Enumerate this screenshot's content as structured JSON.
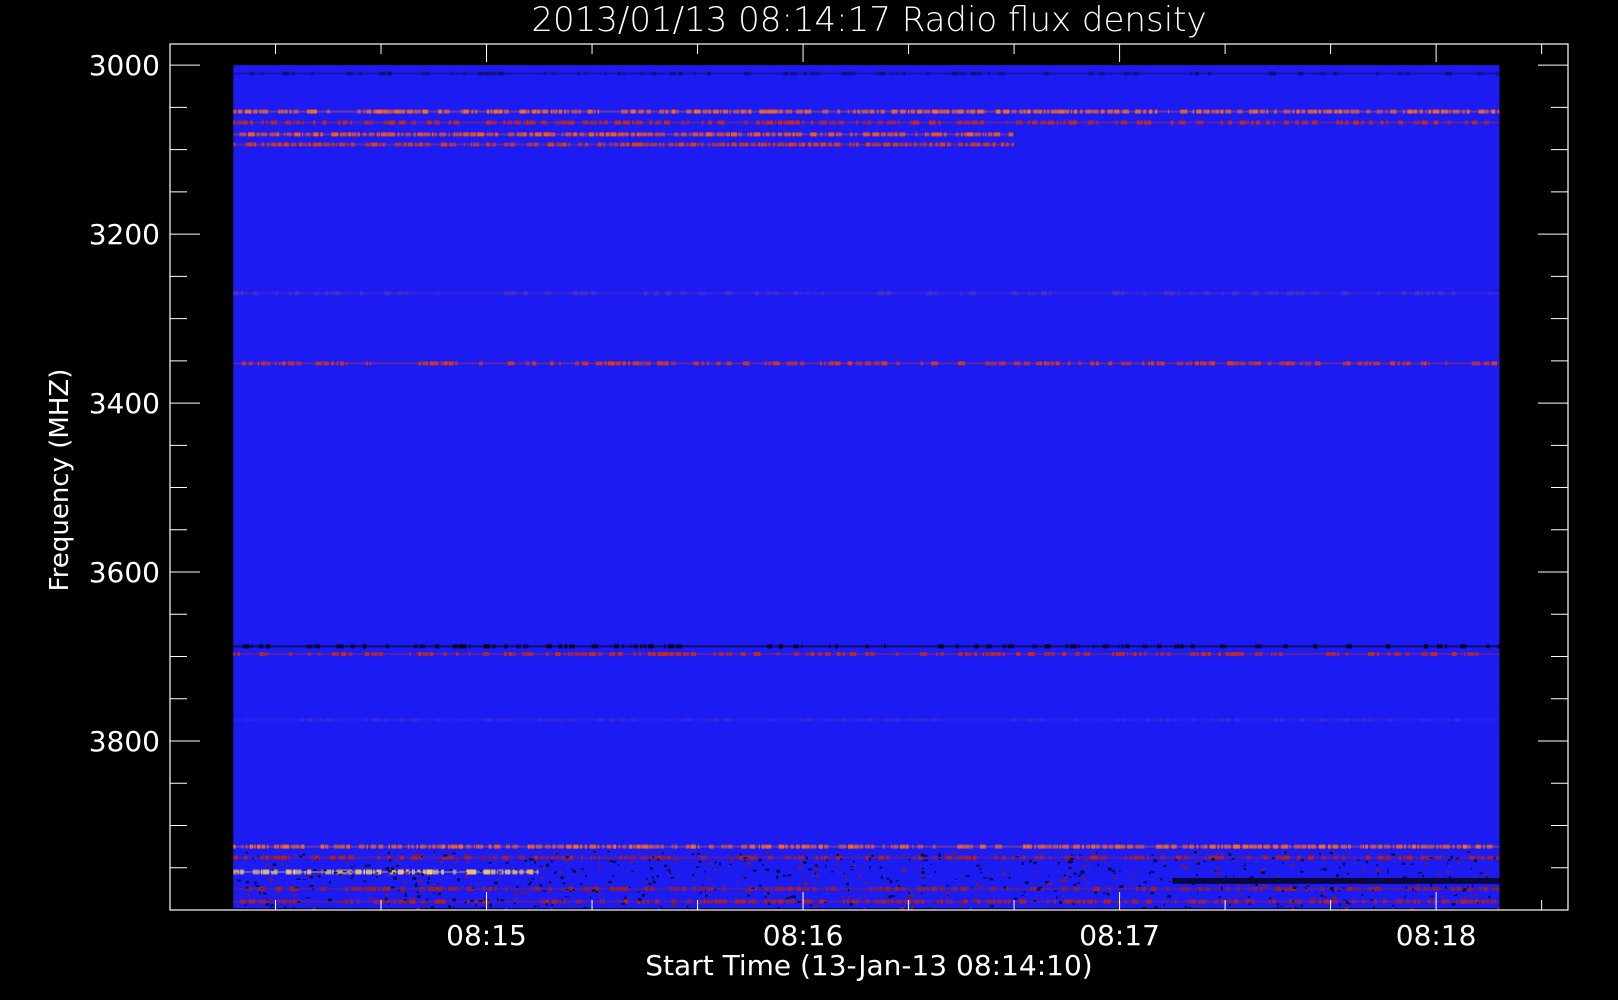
{
  "chart_data": {
    "type": "heatmap",
    "title": "2013/01/13 08:14:17 Radio flux density",
    "xlabel": "Start Time (13-Jan-13 08:14:10)",
    "ylabel": "Frequency (MHZ)",
    "x_ticks": [
      "08:15",
      "08:16",
      "08:17",
      "08:18"
    ],
    "y_ticks": [
      "3000",
      "3200",
      "3400",
      "3600",
      "3800"
    ],
    "y_tick_values": [
      3000,
      3200,
      3400,
      3600,
      3800
    ],
    "x_tick_seconds": [
      50,
      110,
      170,
      230
    ],
    "xlim_seconds": [
      -10,
      255
    ],
    "ylim": [
      2975,
      4000
    ],
    "data_extent": {
      "time_seconds": [
        2,
        242
      ],
      "frequency_mhz": [
        3000,
        3998
      ]
    },
    "orientation": "frequency increases downward",
    "background_color": "#1c1cf2",
    "colormap": [
      "#000000",
      "#1c1cf2",
      "#cc1a00",
      "#ff6a00",
      "#ffd060",
      "#ffffff"
    ],
    "grid": false,
    "bands": [
      {
        "freq": 3010,
        "intensity": "low",
        "color": "#101070",
        "time_range_seconds": [
          2,
          242
        ]
      },
      {
        "freq": 3055,
        "intensity": "high",
        "color": "#ff6a1a",
        "time_range_seconds": [
          2,
          242
        ]
      },
      {
        "freq": 3068,
        "intensity": "medium",
        "color": "#d02a10",
        "time_range_seconds": [
          2,
          242
        ]
      },
      {
        "freq": 3082,
        "intensity": "high",
        "color": "#ff5a10",
        "time_range_seconds": [
          2,
          150
        ]
      },
      {
        "freq": 3094,
        "intensity": "high",
        "color": "#e04010",
        "time_range_seconds": [
          2,
          150
        ]
      },
      {
        "freq": 3270,
        "intensity": "low",
        "color": "#5030c0",
        "time_range_seconds": [
          2,
          242
        ]
      },
      {
        "freq": 3353,
        "intensity": "medium",
        "color": "#e03a10",
        "time_range_seconds": [
          2,
          242
        ]
      },
      {
        "freq": 3688,
        "intensity": "low",
        "color": "#000000",
        "time_range_seconds": [
          2,
          242
        ]
      },
      {
        "freq": 3697,
        "intensity": "medium",
        "color": "#d02a10",
        "time_range_seconds": [
          2,
          242
        ]
      },
      {
        "freq": 3775,
        "intensity": "low",
        "color": "#3a2ae0",
        "time_range_seconds": [
          2,
          242
        ]
      },
      {
        "freq": 3925,
        "intensity": "high",
        "color": "#ff6a1a",
        "time_range_seconds": [
          2,
          242
        ]
      },
      {
        "freq": 3938,
        "intensity": "medium",
        "color": "#c02010",
        "time_range_seconds": [
          2,
          242
        ]
      },
      {
        "freq": 3955,
        "intensity": "very high",
        "color": "#ffd060",
        "time_range_seconds": [
          2,
          60
        ]
      },
      {
        "freq": 3975,
        "intensity": "medium",
        "color": "#b02010",
        "time_range_seconds": [
          2,
          242
        ]
      },
      {
        "freq": 3990,
        "intensity": "medium",
        "color": "#c02010",
        "time_range_seconds": [
          2,
          242
        ]
      }
    ]
  }
}
